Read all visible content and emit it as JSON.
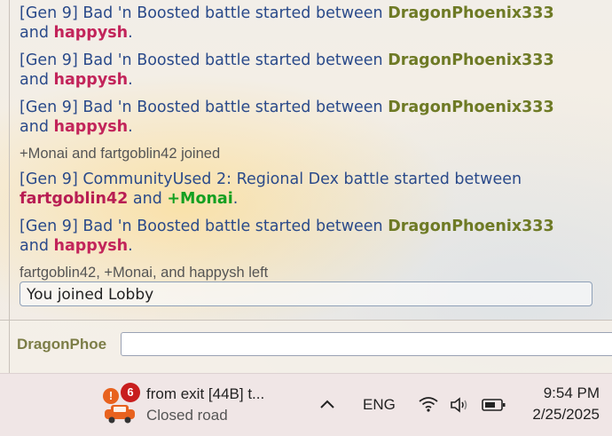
{
  "chat": {
    "messages": [
      {
        "type": "battle",
        "prefix": "[Gen 9] Bad 'n Boosted battle started between ",
        "p1": "DragonPhoenix333",
        "mid": "and ",
        "p2": "happysh",
        "end": "."
      },
      {
        "type": "battle",
        "prefix": "[Gen 9] Bad 'n Boosted battle started between ",
        "p1": "DragonPhoenix333",
        "mid": "and ",
        "p2": "happysh",
        "end": "."
      },
      {
        "type": "battle",
        "prefix": "[Gen 9] Bad 'n Boosted battle started between ",
        "p1": "DragonPhoenix333",
        "mid": "and ",
        "p2": "happysh",
        "end": "."
      },
      {
        "type": "notice",
        "text": "+Monai and fartgoblin42 joined"
      },
      {
        "type": "battle2",
        "prefix": "[Gen 9] CommunityUsed 2: Regional Dex battle started between",
        "p1": "fartgoblin42",
        "mid": " and ",
        "p2": "+Monai",
        "end": "."
      },
      {
        "type": "battle",
        "prefix": "[Gen 9] Bad 'n Boosted battle started between ",
        "p1": "DragonPhoenix333",
        "mid": "and ",
        "p2": "happysh",
        "end": "."
      },
      {
        "type": "notice",
        "text": "fartgoblin42, +Monai, and happysh left"
      }
    ],
    "joined_text": "You joined Lobby"
  },
  "compose": {
    "username": "DragonPhoe",
    "input_value": ""
  },
  "taskbar": {
    "app_title": "from exit [44B] t...",
    "app_subtitle": "Closed road",
    "badge_count": "6",
    "warn_glyph": "!",
    "chevron": "^",
    "language": "ENG",
    "time": "9:54 PM",
    "date": "2/25/2025"
  },
  "colors": {
    "battle_text": "#2a4a8a",
    "player_olive": "#6e7a25",
    "player_pink": "#c2245a",
    "player_green": "#14a021",
    "badge_red": "#c81e1e"
  },
  "icons": [
    "car-icon",
    "warning-icon",
    "chevron-up-icon",
    "wifi-icon",
    "volume-icon",
    "battery-icon"
  ]
}
